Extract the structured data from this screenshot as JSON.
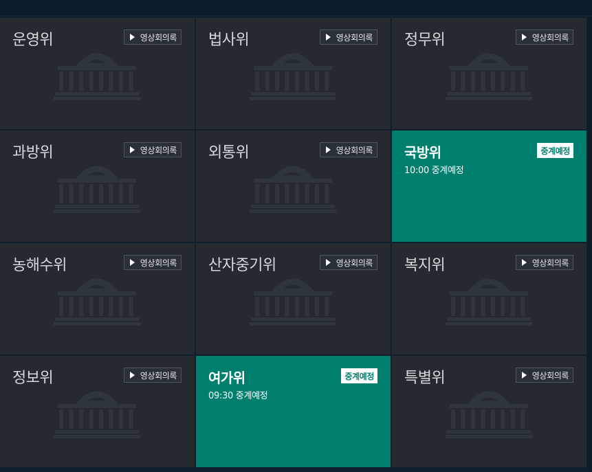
{
  "colors": {
    "page_bg": "#0f1e2b",
    "cell_bg": "#252a31",
    "live_bg": "#017f6e",
    "watermark": "#2f353d"
  },
  "icons": {
    "play": "play-icon",
    "watermark": "national-assembly-building-icon"
  },
  "cells": [
    {
      "name": "운영위",
      "status": "vod",
      "button_label": "영상회의록"
    },
    {
      "name": "법사위",
      "status": "vod",
      "button_label": "영상회의록"
    },
    {
      "name": "정무위",
      "status": "vod",
      "button_label": "영상회의록"
    },
    {
      "name": "과방위",
      "status": "vod",
      "button_label": "영상회의록"
    },
    {
      "name": "외통위",
      "status": "vod",
      "button_label": "영상회의록"
    },
    {
      "name": "국방위",
      "status": "live",
      "badge_label": "중계예정",
      "time_text": "10:00 중계예정"
    },
    {
      "name": "농해수위",
      "status": "vod",
      "button_label": "영상회의록"
    },
    {
      "name": "산자중기위",
      "status": "vod",
      "button_label": "영상회의록"
    },
    {
      "name": "복지위",
      "status": "vod",
      "button_label": "영상회의록"
    },
    {
      "name": "정보위",
      "status": "vod",
      "button_label": "영상회의록"
    },
    {
      "name": "여가위",
      "status": "live",
      "badge_label": "중계예정",
      "time_text": "09:30 중계예정"
    },
    {
      "name": "특별위",
      "status": "vod",
      "button_label": "영상회의록"
    }
  ]
}
